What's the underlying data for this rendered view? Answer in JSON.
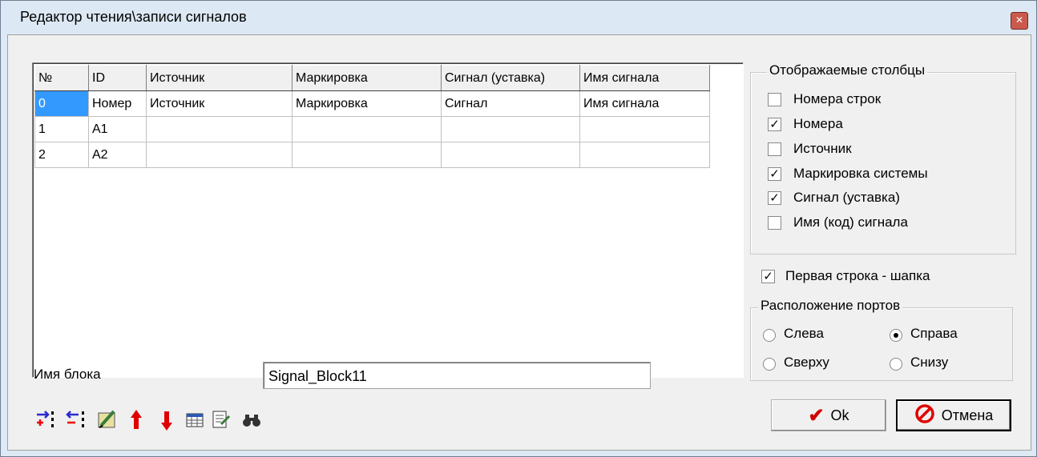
{
  "window": {
    "title": "Редактор чтения\\записи сигналов",
    "close_glyph": "✕"
  },
  "table": {
    "headers": [
      "№",
      "ID",
      "Источник",
      "Маркировка",
      "Сигнал (уставка)",
      "Имя сигнала"
    ],
    "rows": [
      [
        "0",
        "Номер",
        "Источник",
        "Маркировка",
        "Сигнал",
        "Имя сигнала"
      ],
      [
        "1",
        "A1",
        "",
        "",
        "",
        ""
      ],
      [
        "2",
        "A2",
        "",
        "",
        "",
        ""
      ]
    ]
  },
  "block_name": {
    "label": "Имя блока",
    "value": "Signal_Block11"
  },
  "toolbar": {
    "icons": [
      "add-column-icon",
      "remove-column-icon",
      "edit-icon",
      "move-up-icon",
      "move-down-icon",
      "table-icon",
      "export-icon",
      "find-icon"
    ]
  },
  "columns_group": {
    "title": "Отображаемые столбцы",
    "items": [
      {
        "label": "Номера строк",
        "checked": false
      },
      {
        "label": "Номера",
        "checked": true
      },
      {
        "label": "Источник",
        "checked": false
      },
      {
        "label": "Маркировка системы",
        "checked": true
      },
      {
        "label": "Сигнал (уставка)",
        "checked": true
      },
      {
        "label": "Имя (код) сигнала",
        "checked": false
      }
    ]
  },
  "first_row_header": {
    "label": "Первая строка - шапка",
    "checked": true
  },
  "ports_group": {
    "title": "Расположение портов",
    "options": [
      {
        "label": "Слева",
        "selected": false
      },
      {
        "label": "Справа",
        "selected": true
      },
      {
        "label": "Сверху",
        "selected": false
      },
      {
        "label": "Снизу",
        "selected": false
      }
    ]
  },
  "buttons": {
    "ok": "Ok",
    "cancel": "Отмена"
  },
  "check_glyph": "✓"
}
